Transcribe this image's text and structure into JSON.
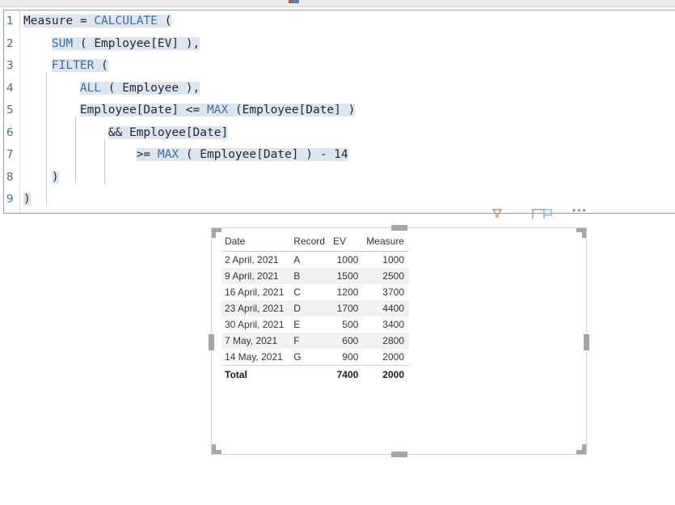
{
  "top_toolbar": {
    "icon": "ribbon-icon-fragment"
  },
  "code_editor": {
    "language": "DAX",
    "lines": [
      {
        "number": "1",
        "text": "Measure = CALCULATE ("
      },
      {
        "number": "2",
        "text": "    SUM ( Employee[EV] ),"
      },
      {
        "number": "3",
        "text": "    FILTER ("
      },
      {
        "number": "4",
        "text": "        ALL ( Employee ),"
      },
      {
        "number": "5",
        "text": "        Employee[Date] <= MAX (Employee[Date] )"
      },
      {
        "number": "6",
        "text": "            && Employee[Date]"
      },
      {
        "number": "7",
        "text": "                >= MAX ( Employee[Date] ) - 14"
      },
      {
        "number": "8",
        "text": "    )"
      },
      {
        "number": "9",
        "text": ")"
      }
    ],
    "keywords": [
      "CALCULATE",
      "SUM",
      "FILTER",
      "ALL",
      "MAX"
    ],
    "keyword_color": "#3a6ea5",
    "selection_color": "#dde5f0",
    "line_number_color": "#3a6ea5"
  },
  "visual_header": {
    "icons": [
      {
        "name": "filter-icon",
        "label": "Filters"
      },
      {
        "name": "focus-mode-icon",
        "label": "Focus mode"
      },
      {
        "name": "more-options-icon",
        "label": "More options"
      }
    ]
  },
  "table_visual": {
    "selected": true,
    "columns": [
      {
        "key": "date",
        "label": "Date",
        "align": "left"
      },
      {
        "key": "record",
        "label": "Record",
        "align": "left"
      },
      {
        "key": "ev",
        "label": "EV",
        "align": "right"
      },
      {
        "key": "measure",
        "label": "Measure",
        "align": "right"
      }
    ],
    "rows": [
      {
        "date": "2 April, 2021",
        "record": "A",
        "ev": "1000",
        "measure": "1000"
      },
      {
        "date": "9 April, 2021",
        "record": "B",
        "ev": "1500",
        "measure": "2500"
      },
      {
        "date": "16 April, 2021",
        "record": "C",
        "ev": "1200",
        "measure": "3700"
      },
      {
        "date": "23 April, 2021",
        "record": "D",
        "ev": "1700",
        "measure": "4400"
      },
      {
        "date": "30 April, 2021",
        "record": "E",
        "ev": "500",
        "measure": "3400"
      },
      {
        "date": "7 May, 2021",
        "record": "F",
        "ev": "600",
        "measure": "2800"
      },
      {
        "date": "14 May, 2021",
        "record": "G",
        "ev": "900",
        "measure": "2000"
      }
    ],
    "total": {
      "date": "Total",
      "record": "",
      "ev": "7400",
      "measure": "2000"
    },
    "colors": {
      "band": "#f1f1f1",
      "header_rule": "#b5d6e8",
      "text": "#333333"
    }
  },
  "chart_data": {
    "type": "table",
    "title": "",
    "categories": [
      "2 April, 2021",
      "9 April, 2021",
      "16 April, 2021",
      "23 April, 2021",
      "30 April, 2021",
      "7 May, 2021",
      "14 May, 2021"
    ],
    "series": [
      {
        "name": "EV",
        "values": [
          1000,
          1500,
          1200,
          1700,
          500,
          600,
          900
        ]
      },
      {
        "name": "Measure",
        "values": [
          1000,
          2500,
          3700,
          4400,
          3400,
          2800,
          2000
        ]
      }
    ],
    "record_labels": [
      "A",
      "B",
      "C",
      "D",
      "E",
      "F",
      "G"
    ],
    "totals": {
      "EV": 7400,
      "Measure": 2000
    },
    "xlabel": "Date",
    "ylabel": ""
  }
}
